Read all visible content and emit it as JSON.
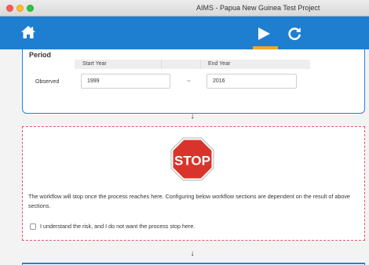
{
  "window": {
    "title": "AIMS - Papua New Guinea Test Project"
  },
  "navbar": {
    "icons": [
      "home-icon",
      "play-icon",
      "refresh-icon"
    ],
    "accent": "#1e7fd0",
    "active_indicator_color": "#f5a623"
  },
  "period": {
    "title": "Period",
    "columns": [
      "Start Year",
      "End Year"
    ],
    "row_label": "Observed",
    "start_year": "1999",
    "end_year": "2016",
    "separator": "~"
  },
  "stop": {
    "sign_text": "STOP",
    "message": "The workflow will stop once the process reaches here. Configuring below workflow sections are dependent on the result of above sections.",
    "checkbox_label": "I understand the risk, and I do not want the process stop here.",
    "border_color": "#e0566a",
    "sign_color": "#d9342b"
  },
  "arrows": [
    "↓",
    "↓"
  ]
}
